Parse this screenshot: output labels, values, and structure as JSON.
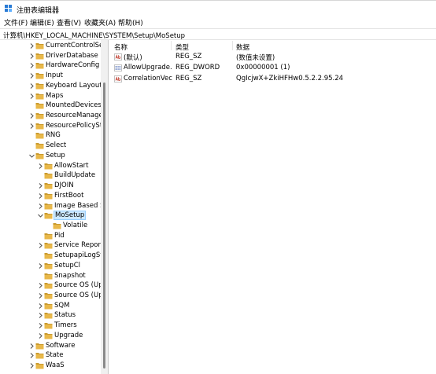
{
  "window": {
    "title": "注册表编辑器"
  },
  "menu": [
    "文件(F)",
    "编辑(E)",
    "查看(V)",
    "收藏夹(A)",
    "帮助(H)"
  ],
  "address": {
    "path": "计算机\\HKEY_LOCAL_MACHINE\\SYSTEM\\Setup\\MoSetup"
  },
  "tree": {
    "items": [
      {
        "label": "CurrentControlSet",
        "level": 1,
        "expander": "collapsed"
      },
      {
        "label": "DriverDatabase",
        "level": 1,
        "expander": "collapsed"
      },
      {
        "label": "HardwareConfig",
        "level": 1,
        "expander": "collapsed"
      },
      {
        "label": "Input",
        "level": 1,
        "expander": "collapsed"
      },
      {
        "label": "Keyboard Layout",
        "level": 1,
        "expander": "collapsed"
      },
      {
        "label": "Maps",
        "level": 1,
        "expander": "collapsed"
      },
      {
        "label": "MountedDevices",
        "level": 1,
        "expander": "none"
      },
      {
        "label": "ResourceManager",
        "level": 1,
        "expander": "collapsed"
      },
      {
        "label": "ResourcePolicySto",
        "level": 1,
        "expander": "collapsed"
      },
      {
        "label": "RNG",
        "level": 1,
        "expander": "none"
      },
      {
        "label": "Select",
        "level": 1,
        "expander": "none"
      },
      {
        "label": "Setup",
        "level": 1,
        "expander": "expanded"
      },
      {
        "label": "AllowStart",
        "level": 2,
        "expander": "collapsed"
      },
      {
        "label": "BuildUpdate",
        "level": 2,
        "expander": "none"
      },
      {
        "label": "DJOIN",
        "level": 2,
        "expander": "collapsed"
      },
      {
        "label": "FirstBoot",
        "level": 2,
        "expander": "collapsed"
      },
      {
        "label": "Image Based Se",
        "level": 2,
        "expander": "collapsed"
      },
      {
        "label": "MoSetup",
        "level": 2,
        "expander": "expanded",
        "selected": true
      },
      {
        "label": "Volatile",
        "level": 3,
        "expander": "none"
      },
      {
        "label": "Pid",
        "level": 2,
        "expander": "none"
      },
      {
        "label": "Service Reportin",
        "level": 2,
        "expander": "collapsed"
      },
      {
        "label": "SetupapiLogSta",
        "level": 2,
        "expander": "none"
      },
      {
        "label": "SetupCl",
        "level": 2,
        "expander": "collapsed"
      },
      {
        "label": "Snapshot",
        "level": 2,
        "expander": "none"
      },
      {
        "label": "Source OS (Upc",
        "level": 2,
        "expander": "collapsed"
      },
      {
        "label": "Source OS (Upc",
        "level": 2,
        "expander": "collapsed"
      },
      {
        "label": "SQM",
        "level": 2,
        "expander": "collapsed"
      },
      {
        "label": "Status",
        "level": 2,
        "expander": "collapsed"
      },
      {
        "label": "Timers",
        "level": 2,
        "expander": "collapsed"
      },
      {
        "label": "Upgrade",
        "level": 2,
        "expander": "collapsed"
      },
      {
        "label": "Software",
        "level": 1,
        "expander": "collapsed"
      },
      {
        "label": "State",
        "level": 1,
        "expander": "collapsed"
      },
      {
        "label": "WaaS",
        "level": 1,
        "expander": "collapsed"
      }
    ]
  },
  "list": {
    "headers": {
      "name": "名称",
      "type": "类型",
      "data": "数据"
    },
    "rows": [
      {
        "icon": "string-value-icon",
        "name": "(默认)",
        "type": "REG_SZ",
        "data": "(数值未设置)"
      },
      {
        "icon": "binary-value-icon",
        "name": "AllowUpgrade...",
        "type": "REG_DWORD",
        "data": "0x00000001 (1)"
      },
      {
        "icon": "string-value-icon",
        "name": "CorrelationVec...",
        "type": "REG_SZ",
        "data": "QgIcjwX+ZkiHFHw0.5.2.2.95.24"
      }
    ]
  },
  "colors": {
    "folder": "#e8b84a",
    "folder_dark": "#c99a2e",
    "selection": "#cce8ff",
    "string_icon": "#c0392b",
    "binary_icon": "#2a4fa8"
  }
}
